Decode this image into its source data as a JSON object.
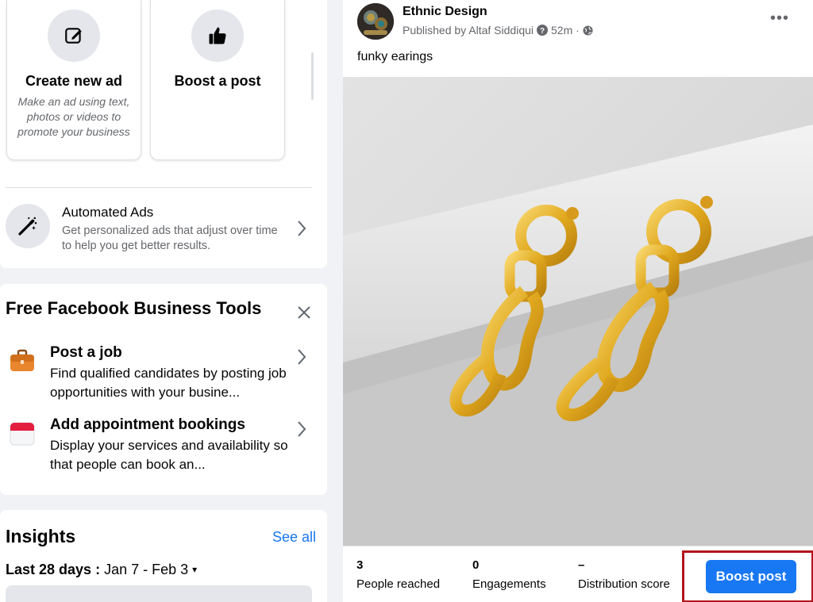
{
  "ad_tiles": {
    "create": {
      "title": "Create new ad",
      "desc": "Make an ad using text, photos or videos to promote your business"
    },
    "boost": {
      "title": "Boost a post"
    }
  },
  "automated_ads": {
    "title": "Automated Ads",
    "desc": "Get personalized ads that adjust over time to help you get better results."
  },
  "tools": {
    "title": "Free Facebook Business Tools",
    "items": [
      {
        "title": "Post a job",
        "desc": "Find qualified candidates by posting job opportunities with your busine..."
      },
      {
        "title": "Add appointment bookings",
        "desc": "Display your services and availability so that people can book an..."
      }
    ]
  },
  "insights": {
    "title": "Insights",
    "see_all": "See all",
    "range_label": "Last 28 days :",
    "range_value": "Jan 7 - Feb 3",
    "caret": "▾"
  },
  "post": {
    "page_name": "Ethnic Design",
    "published_by": "Published by Altaf Siddiqui",
    "time": "52m ·",
    "more": "•••",
    "caption": "funky earings",
    "stats": [
      {
        "value": "3",
        "label": "People reached"
      },
      {
        "value": "0",
        "label": "Engagements"
      },
      {
        "value": "–",
        "label": "Distribution score"
      }
    ],
    "boost_button": "Boost post"
  },
  "colors": {
    "accent": "#1877f2",
    "highlight_frame": "#b3141b",
    "background": "#f0f2f5"
  },
  "icons": [
    "edit-icon",
    "thumbs-up-icon",
    "magic-wand-icon",
    "chevron-right-icon",
    "close-icon",
    "briefcase-icon",
    "calendar-icon",
    "question-icon",
    "globe-icon"
  ]
}
